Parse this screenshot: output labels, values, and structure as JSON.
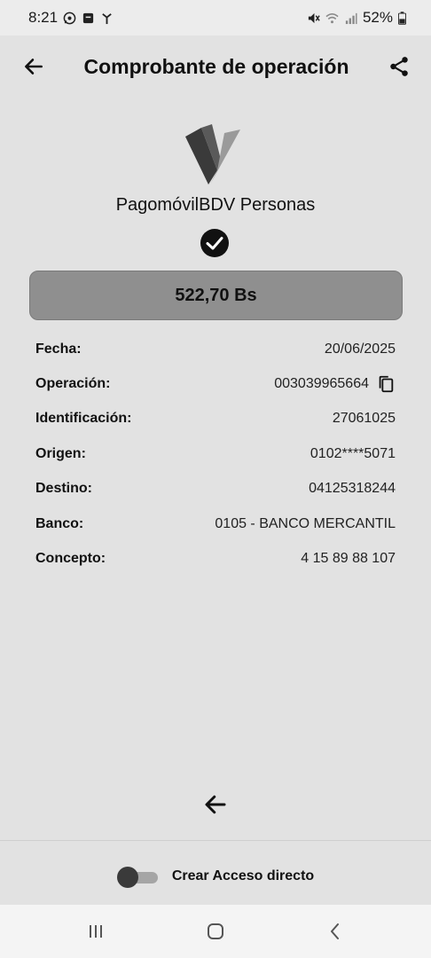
{
  "status_bar": {
    "time": "8:21",
    "battery": "52%",
    "icons": [
      "whatsapp-icon",
      "message-icon",
      "antenna-icon",
      "mute-icon",
      "wifi-icon",
      "signal-icon",
      "battery-icon"
    ]
  },
  "header": {
    "title": "Comprobante de operación",
    "back_icon": "arrow-left-icon",
    "share_icon": "share-icon"
  },
  "brand": {
    "name": "PagomóvilBDV Personas"
  },
  "amount": {
    "value": "522,70 Bs"
  },
  "details": [
    {
      "label": "Fecha:",
      "value": "20/06/2025"
    },
    {
      "label": "Operación:",
      "value": "003039965664"
    },
    {
      "label": "Identificación:",
      "value": "27061025"
    },
    {
      "label": "Origen:",
      "value": "0102****5071"
    },
    {
      "label": "Destino:",
      "value": "04125318244"
    },
    {
      "label": "Banco:",
      "value": "0105 - BANCO MERCANTIL"
    },
    {
      "label": "Concepto:",
      "value": "4 15 89 88 107"
    }
  ],
  "shortcut": {
    "label": "Crear Acceso directo",
    "enabled": false
  },
  "colors": {
    "background": "#e2e2e2",
    "amount_box": "#8f8f8f"
  }
}
